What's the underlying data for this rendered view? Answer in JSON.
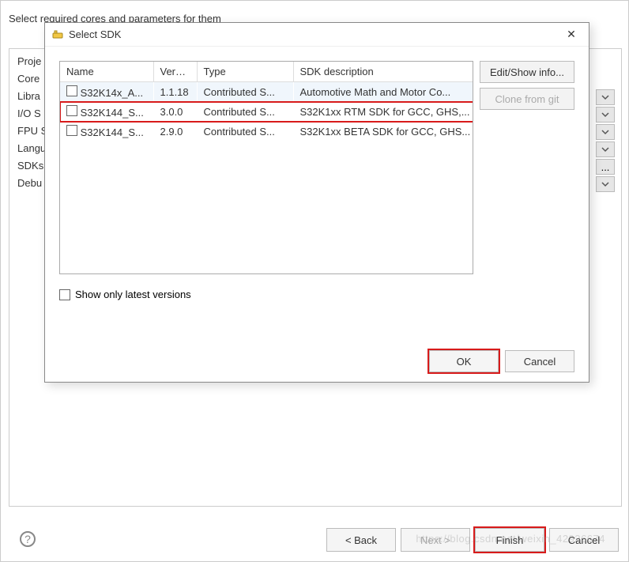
{
  "bg": {
    "subtitle": "Select required cores and parameters for them",
    "list": [
      "Proje",
      "Core",
      "Libra",
      "I/O S",
      "FPU S",
      "Langu",
      "SDKs",
      "Debu"
    ],
    "buttons": {
      "back": "< Back",
      "next": "Next >",
      "finish": "Finish",
      "cancel": "Cancel"
    }
  },
  "modal": {
    "title": "Select SDK",
    "columns": {
      "name": "Name",
      "version": "Versi...",
      "type": "Type",
      "desc": "SDK description"
    },
    "rows": [
      {
        "name": "S32K14x_A...",
        "version": "1.1.18",
        "type": "Contributed S...",
        "desc": "Automotive Math and Motor Co..."
      },
      {
        "name": "S32K144_S...",
        "version": "3.0.0",
        "type": "Contributed S...",
        "desc": "S32K1xx RTM SDK for GCC, GHS,..."
      },
      {
        "name": "S32K144_S...",
        "version": "2.9.0",
        "type": "Contributed S...",
        "desc": "S32K1xx BETA SDK for GCC, GHS..."
      }
    ],
    "side": {
      "edit": "Edit/Show info...",
      "clone": "Clone from git"
    },
    "show_only": "Show only latest versions",
    "buttons": {
      "ok": "OK",
      "cancel": "Cancel"
    }
  },
  "watermark": "https://blog.csdn.net/weixin_42936674"
}
